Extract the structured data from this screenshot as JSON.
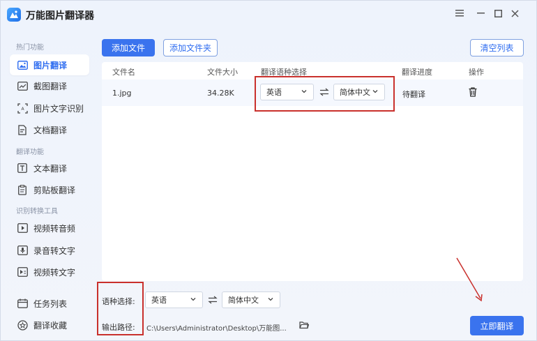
{
  "app": {
    "title": "万能图片翻译器"
  },
  "window": {
    "menu_icon": "hamburger-icon",
    "minimize_icon": "minimize-icon",
    "maximize_icon": "maximize-icon",
    "close_icon": "close-icon"
  },
  "sidebar": {
    "section1": "热门功能",
    "section2": "翻译功能",
    "section3": "识别转换工具",
    "items": [
      {
        "label": "图片翻译",
        "icon": "image-icon",
        "active": true
      },
      {
        "label": "截图翻译",
        "icon": "screenshot-icon"
      },
      {
        "label": "图片文字识别",
        "icon": "ocr-icon"
      },
      {
        "label": "文档翻译",
        "icon": "document-icon"
      },
      {
        "label": "文本翻译",
        "icon": "text-icon"
      },
      {
        "label": "剪贴板翻译",
        "icon": "clipboard-icon"
      },
      {
        "label": "视频转音频",
        "icon": "video-audio-icon"
      },
      {
        "label": "录音转文字",
        "icon": "mic-icon"
      },
      {
        "label": "视频转文字",
        "icon": "video-text-icon"
      },
      {
        "label": "任务列表",
        "icon": "calendar-icon"
      },
      {
        "label": "翻译收藏",
        "icon": "star-icon"
      }
    ]
  },
  "toolbar": {
    "add_file": "添加文件",
    "add_folder": "添加文件夹",
    "clear_list": "清空列表"
  },
  "table": {
    "headers": [
      "文件名",
      "文件大小",
      "翻译语种选择",
      "翻译进度",
      "操作"
    ],
    "rows": [
      {
        "name": "1.jpg",
        "size": "34.28K",
        "source_lang": "英语",
        "target_lang": "简体中文",
        "status": "待翻译"
      }
    ]
  },
  "bottom": {
    "lang_label": "语种选择:",
    "source_lang": "英语",
    "target_lang": "简体中文",
    "path_label": "输出路径:",
    "path_value": "C:\\Users\\Administrator\\Desktop\\万能图...",
    "translate_button": "立即翻译"
  },
  "colors": {
    "accent": "#3a73ee",
    "annotation": "#c9302c"
  }
}
